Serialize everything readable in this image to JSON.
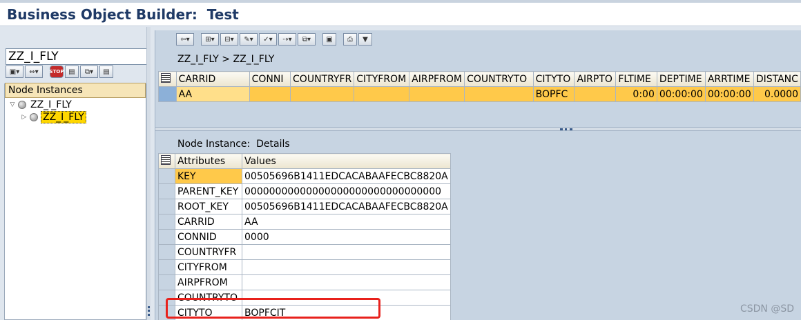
{
  "window": {
    "title": "Business Object Builder:  Test"
  },
  "left": {
    "search_value": "ZZ_I_FLY",
    "tree_header": "Node Instances",
    "tree": [
      {
        "label": "ZZ_I_FLY",
        "expanded": true,
        "selected": false
      },
      {
        "label": "ZZ_I_FLY",
        "expanded": false,
        "selected": true
      }
    ]
  },
  "right": {
    "path": "ZZ_I_FLY > ZZ_I_FLY",
    "columns": [
      "CARRID",
      "CONNI",
      "COUNTRYFR",
      "CITYFROM",
      "AIRPFROM",
      "COUNTRYTO",
      "CITYTO",
      "AIRPTO",
      "FLTIME",
      "DEPTIME",
      "ARRTIME",
      "DISTANC"
    ],
    "row": [
      "AA",
      "",
      "",
      "",
      "",
      "",
      "BOPFC",
      "",
      "0:00",
      "00:00:00",
      "00:00:00",
      "0.0000"
    ],
    "details_label": "Node Instance:  Details",
    "attr_headers": {
      "attribute": "Attributes",
      "value": "Values"
    },
    "attributes": [
      {
        "name": "KEY",
        "value": "00505696B1411EDCACABAAFECBC8820A"
      },
      {
        "name": "PARENT_KEY",
        "value": "00000000000000000000000000000000"
      },
      {
        "name": "ROOT_KEY",
        "value": "00505696B1411EDCACABAAFECBC8820A"
      },
      {
        "name": "CARRID",
        "value": "AA"
      },
      {
        "name": "CONNID",
        "value": "0000"
      },
      {
        "name": "COUNTRYFR",
        "value": ""
      },
      {
        "name": "CITYFROM",
        "value": ""
      },
      {
        "name": "AIRPFROM",
        "value": ""
      },
      {
        "name": "COUNTRYTO",
        "value": ""
      },
      {
        "name": "CITYTO",
        "value": "BOPFCIT"
      }
    ]
  },
  "watermark": "CSDN @SD",
  "colors": {
    "highlight": "#e8211c",
    "selected_row": "#ffc94a",
    "title": "#1f3a66"
  }
}
